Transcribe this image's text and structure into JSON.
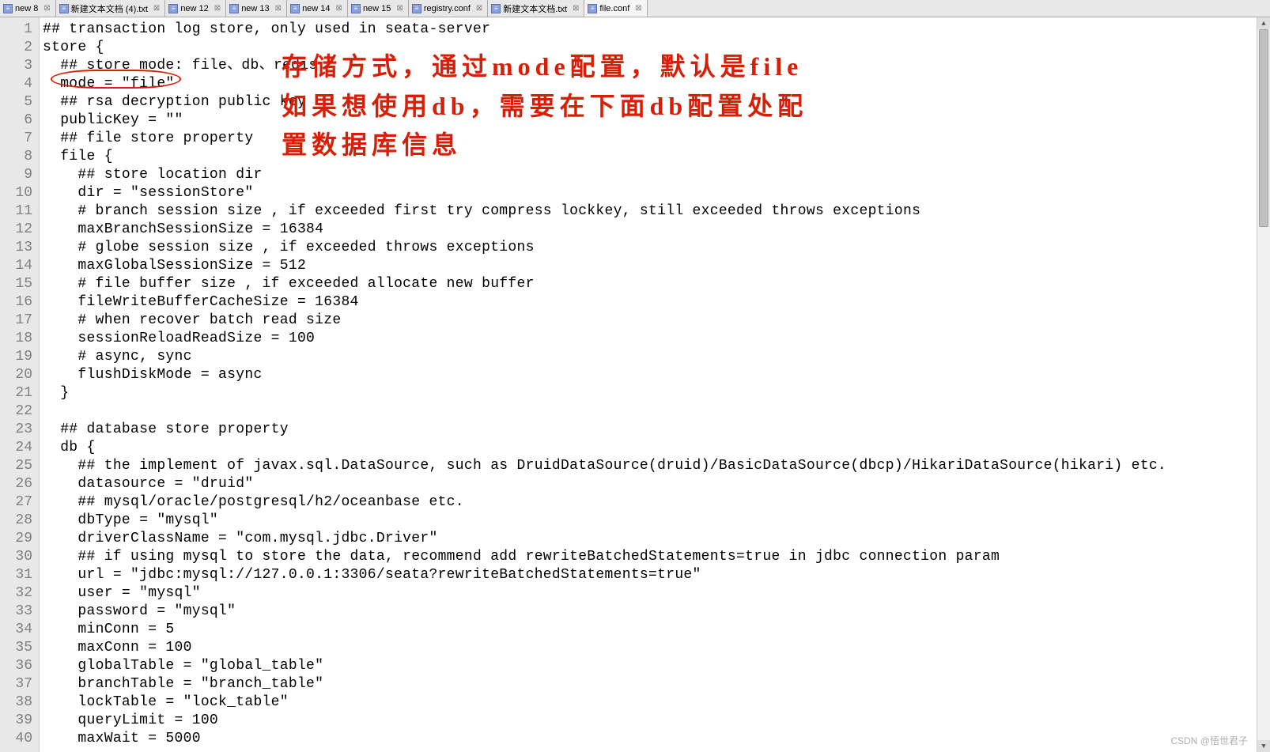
{
  "tabs": [
    {
      "label": "new 8",
      "active": false
    },
    {
      "label": "新建文本文档 (4).txt",
      "active": false
    },
    {
      "label": "new 12",
      "active": false
    },
    {
      "label": "new 13",
      "active": false
    },
    {
      "label": "new 14",
      "active": false
    },
    {
      "label": "new 15",
      "active": false
    },
    {
      "label": "registry.conf",
      "active": false
    },
    {
      "label": "新建文本文档.txt",
      "active": false
    },
    {
      "label": "file.conf",
      "active": true
    }
  ],
  "annotation": {
    "line1": "存储方式，通过mode配置，默认是file",
    "line2": "如果想使用db，需要在下面db配置处配",
    "line3": "置数据库信息"
  },
  "code_lines": [
    "## transaction log store, only used in seata-server",
    "store {",
    "  ## store mode: file、db、redis",
    "  mode = \"file\"",
    "  ## rsa decryption public key",
    "  publicKey = \"\"",
    "  ## file store property",
    "  file {",
    "    ## store location dir",
    "    dir = \"sessionStore\"",
    "    # branch session size , if exceeded first try compress lockkey, still exceeded throws exceptions",
    "    maxBranchSessionSize = 16384",
    "    # globe session size , if exceeded throws exceptions",
    "    maxGlobalSessionSize = 512",
    "    # file buffer size , if exceeded allocate new buffer",
    "    fileWriteBufferCacheSize = 16384",
    "    # when recover batch read size",
    "    sessionReloadReadSize = 100",
    "    # async, sync",
    "    flushDiskMode = async",
    "  }",
    "",
    "  ## database store property",
    "  db {",
    "    ## the implement of javax.sql.DataSource, such as DruidDataSource(druid)/BasicDataSource(dbcp)/HikariDataSource(hikari) etc.",
    "    datasource = \"druid\"",
    "    ## mysql/oracle/postgresql/h2/oceanbase etc.",
    "    dbType = \"mysql\"",
    "    driverClassName = \"com.mysql.jdbc.Driver\"",
    "    ## if using mysql to store the data, recommend add rewriteBatchedStatements=true in jdbc connection param",
    "    url = \"jdbc:mysql://127.0.0.1:3306/seata?rewriteBatchedStatements=true\"",
    "    user = \"mysql\"",
    "    password = \"mysql\"",
    "    minConn = 5",
    "    maxConn = 100",
    "    globalTable = \"global_table\"",
    "    branchTable = \"branch_table\"",
    "    lockTable = \"lock_table\"",
    "    queryLimit = 100",
    "    maxWait = 5000"
  ],
  "watermark": "CSDN @悟世君子"
}
